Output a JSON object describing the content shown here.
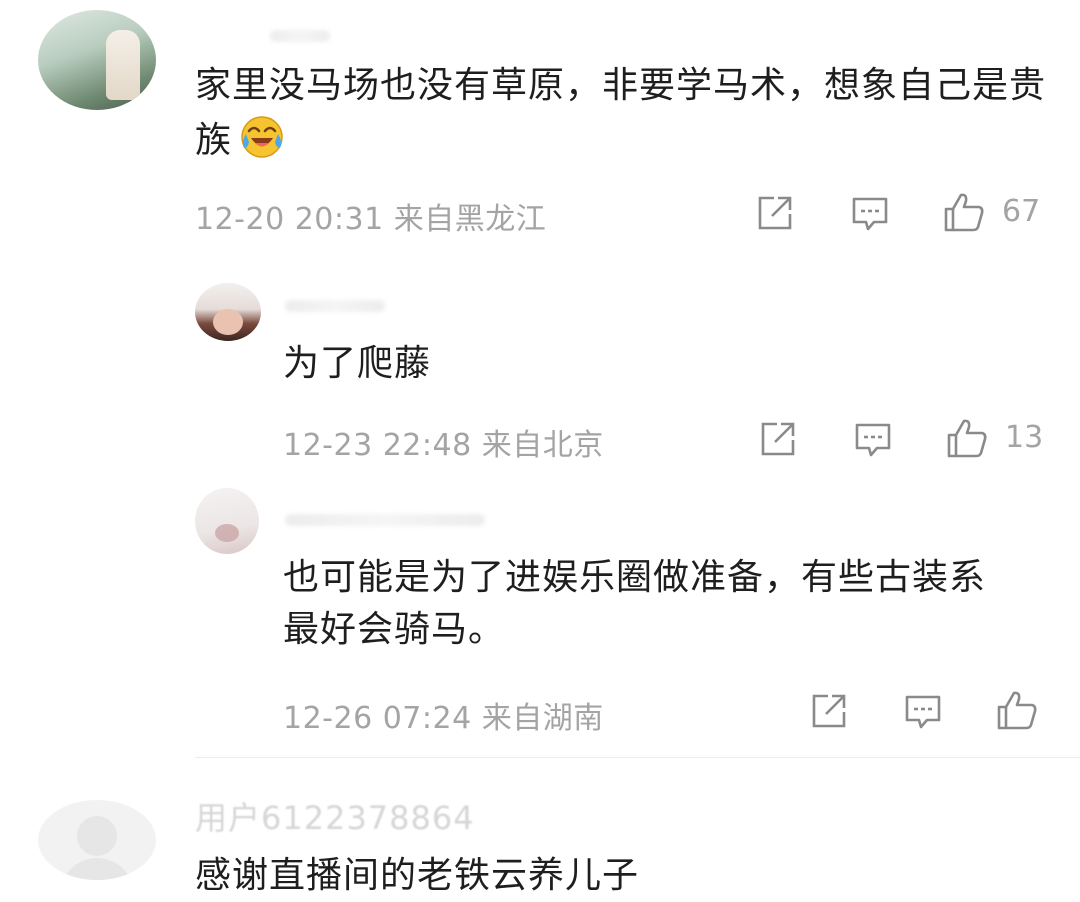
{
  "comments": [
    {
      "text": "家里没马场也没有草原，非要学马术，想象自己是贵族",
      "emoji": "laugh-cry-emoji",
      "time": "12-20 20:31",
      "location": "来自黑龙江",
      "likes": "67"
    },
    {
      "text": "为了爬藤",
      "time": "12-23 22:48",
      "location": "来自北京",
      "likes": "13"
    },
    {
      "text": "也可能是为了进娱乐圈做准备，有些古装系最好会骑马。",
      "time": "12-26 07:24",
      "location": "来自湖南",
      "likes": ""
    },
    {
      "username": "用户6122378864",
      "text": "感谢直播间的老铁云养儿子"
    }
  ],
  "colors": {
    "text": "#1e1e1e",
    "meta": "#a4a4a4",
    "icon": "#8a8a8a",
    "divider": "#ececec",
    "emoji_face": "#f6c430"
  },
  "icons": [
    "share-icon",
    "reply-icon",
    "like-icon"
  ]
}
